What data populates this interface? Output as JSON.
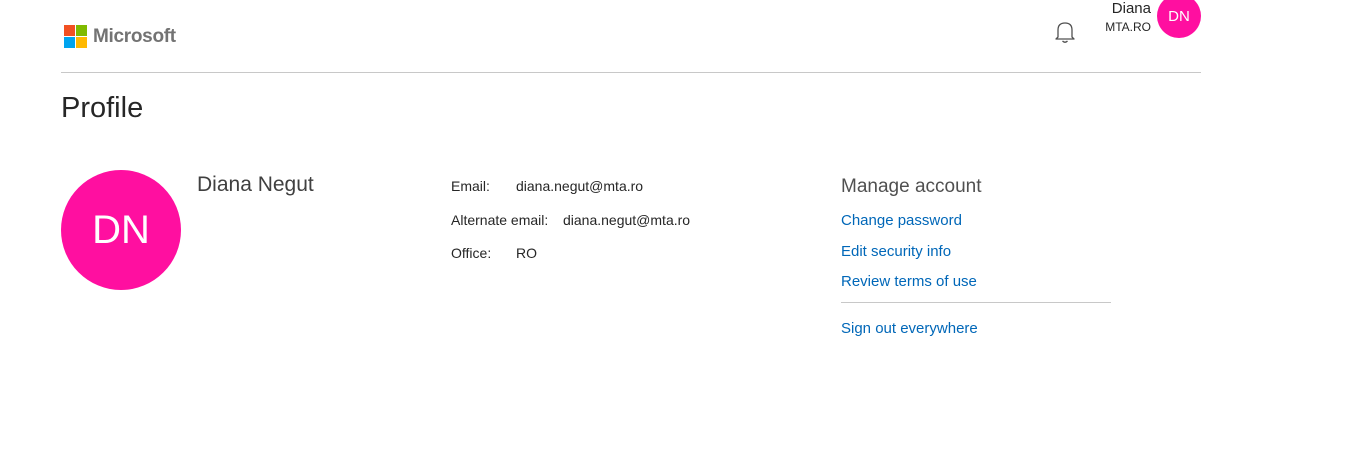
{
  "header": {
    "logo_text": "Microsoft",
    "logo_colors": [
      "#f25022",
      "#7fba00",
      "#00a4ef",
      "#ffb900"
    ],
    "notification_icon": "bell-icon",
    "user_name": "Diana",
    "user_tenant": "MTA.RO",
    "avatar_initials": "DN",
    "avatar_color": "#ff0fa0"
  },
  "page": {
    "title": "Profile"
  },
  "profile": {
    "initials": "DN",
    "avatar_color": "#ff0fa0",
    "full_name": "Diana Negut",
    "details": [
      {
        "label": "Email:",
        "value": "diana.negut@mta.ro"
      },
      {
        "label": "Alternate email:",
        "value": "diana.negut@mta.ro"
      },
      {
        "label": "Office:",
        "value": "RO"
      }
    ]
  },
  "manage_account": {
    "title": "Manage account",
    "links": [
      {
        "label": "Change password"
      },
      {
        "label": "Edit security info"
      },
      {
        "label": "Review terms of use"
      }
    ],
    "sign_out": "Sign out everywhere",
    "link_color": "#0067b8"
  }
}
